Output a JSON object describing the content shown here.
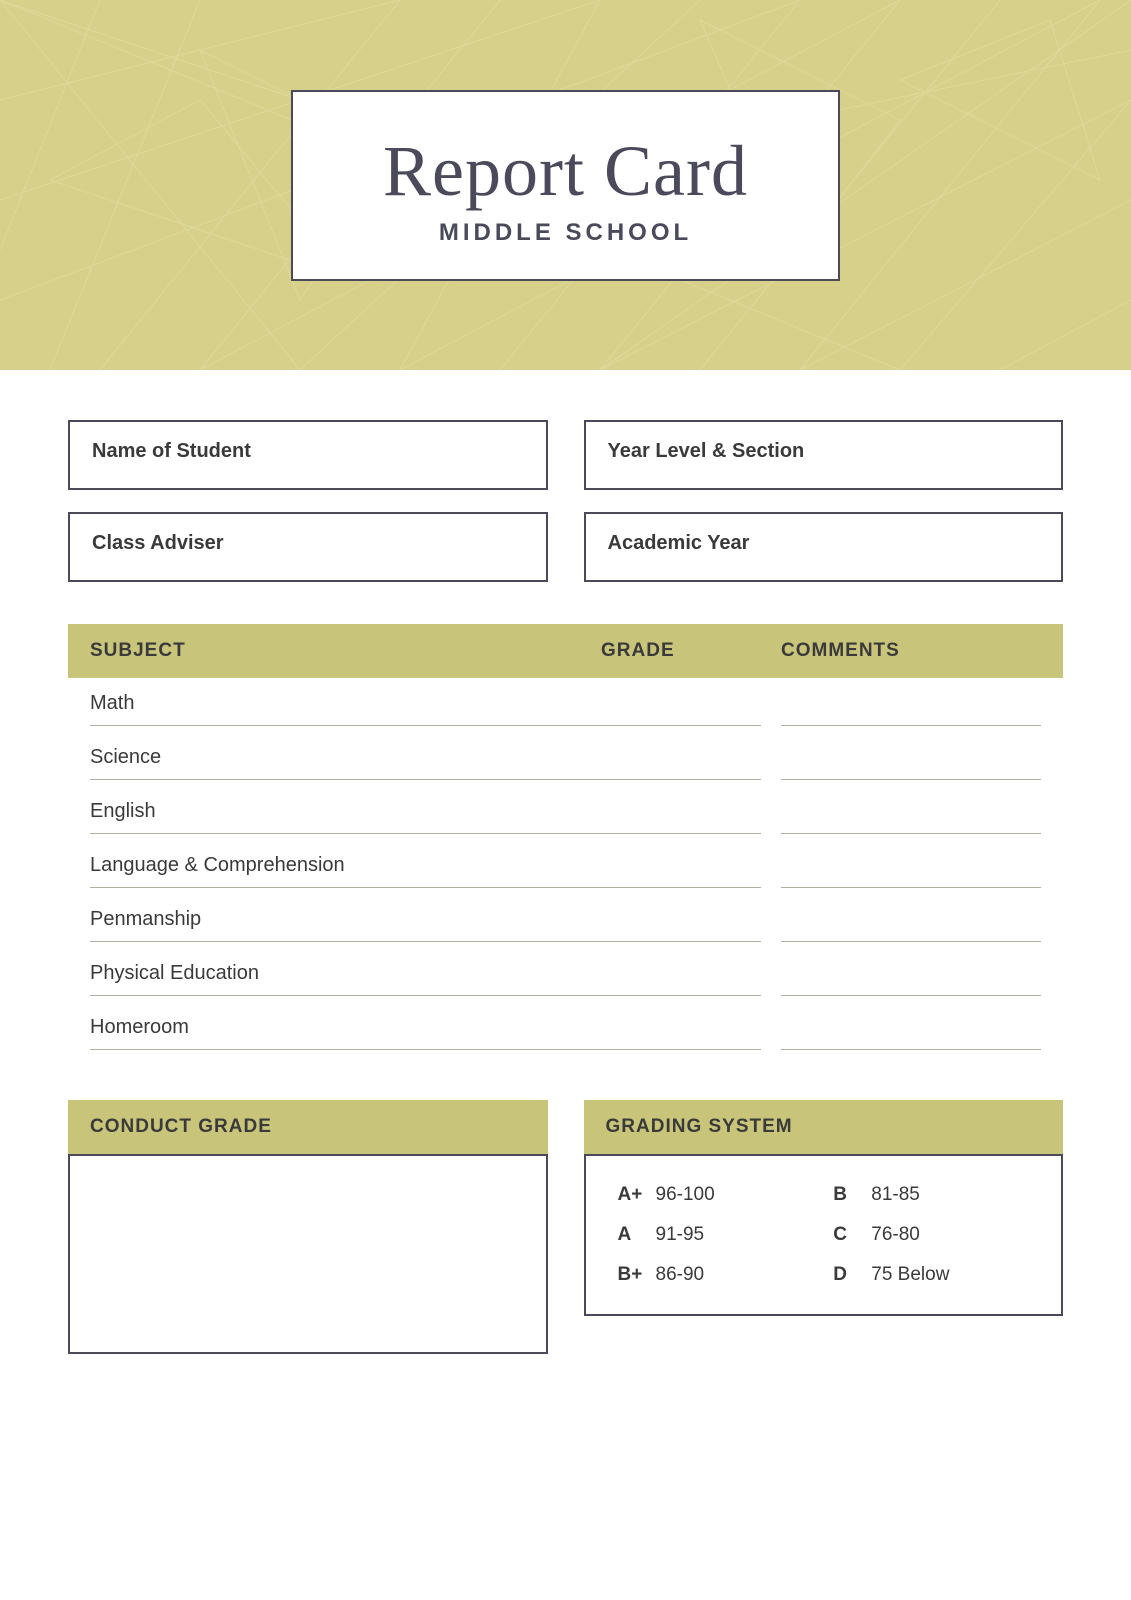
{
  "header": {
    "title": "Report Card",
    "subtitle": "MIDDLE SCHOOL"
  },
  "info_fields": {
    "name_label": "Name of Student",
    "year_label": "Year Level & Section",
    "adviser_label": "Class Adviser",
    "academic_label": "Academic Year"
  },
  "table": {
    "col_subject": "SUBJECT",
    "col_grade": "GRADE",
    "col_comments": "COMMENTS",
    "subjects": [
      "Math",
      "Science",
      "English",
      "Language & Comprehension",
      "Penmanship",
      "Physical Education",
      "Homeroom"
    ]
  },
  "conduct": {
    "header": "CONDUCT GRADE"
  },
  "grading_system": {
    "header": "GRADING SYSTEM",
    "grades": [
      {
        "letter": "A+",
        "range": "96-100"
      },
      {
        "letter": "A",
        "range": "91-95"
      },
      {
        "letter": "B+",
        "range": "86-90"
      },
      {
        "letter": "B",
        "range": "81-85"
      },
      {
        "letter": "C",
        "range": "76-80"
      },
      {
        "letter": "D",
        "range": "75 Below"
      }
    ]
  }
}
